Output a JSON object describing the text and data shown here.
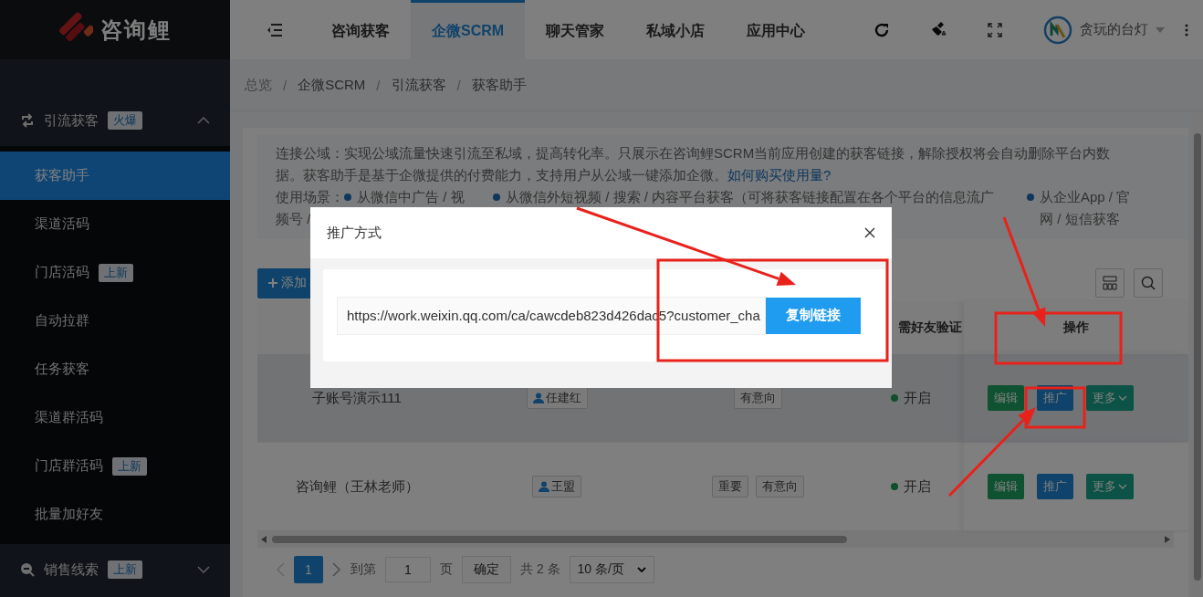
{
  "sidebar": {
    "logo": "咨询鲤",
    "groups": [
      {
        "label": "引流获客",
        "badge": "火爆",
        "expanded": true,
        "items": [
          {
            "label": "获客助手",
            "selected": true
          },
          {
            "label": "渠道活码",
            "selected": false
          },
          {
            "label": "门店活码",
            "badge": "上新",
            "selected": false
          },
          {
            "label": "自动拉群",
            "selected": false
          },
          {
            "label": "任务获客",
            "selected": false
          },
          {
            "label": "渠道群活码",
            "selected": false
          },
          {
            "label": "门店群活码",
            "badge": "上新",
            "selected": false
          },
          {
            "label": "批量加好友",
            "selected": false
          }
        ]
      },
      {
        "label": "销售线索",
        "badge": "上新",
        "expanded": false
      }
    ]
  },
  "header": {
    "tabs": [
      {
        "label": "咨询获客",
        "selected": false
      },
      {
        "label": "企微SCRM",
        "selected": true
      },
      {
        "label": "聊天管家",
        "selected": false
      },
      {
        "label": "私域小店",
        "selected": false
      },
      {
        "label": "应用中心",
        "selected": false
      }
    ],
    "user": "贪玩的台灯"
  },
  "breadcrumb": {
    "separator": "/",
    "items": [
      "总览",
      "企微SCRM",
      "引流获客",
      "获客助手"
    ]
  },
  "notice": {
    "text": "连接公域：实现公域流量快速引流至私域，提高转化率。只展示在咨询鲤SCRM当前应用创建的获客链接，解除授权将会自动删除平台内数据。获客助手是基于企微提供的付费能力，支持用户从公域一键添加企微。",
    "link": "如何购买使用量?",
    "scene_label": "使用场景：",
    "scenes": [
      {
        "lines": [
          "从微信中广告 / 视",
          "频号 /"
        ]
      },
      {
        "lines": [
          "从微信外短视频 / 搜索 / 内容平台获客（可将获客链接配置在各个平台的信息流广"
        ]
      },
      {
        "lines": [
          "从企业App / 官",
          "网 / 短信获客"
        ]
      }
    ]
  },
  "toolbar": {
    "add_button": "添加"
  },
  "table": {
    "columns": [
      "需好友验证",
      "操作"
    ],
    "rows": [
      {
        "name": "子账号演示111",
        "owner": "任建红",
        "tags": [
          "有意向"
        ],
        "status": "开启",
        "hovered": true,
        "actions": [
          {
            "label": "编辑",
            "kind": "edit"
          },
          {
            "label": "推广",
            "kind": "promote"
          },
          {
            "label": "更多",
            "kind": "more"
          }
        ]
      },
      {
        "name": "咨询鲤（王林老师）",
        "owner": "王盟",
        "tags": [
          "重要",
          "有意向"
        ],
        "status": "开启",
        "hovered": false,
        "actions": [
          {
            "label": "编辑",
            "kind": "edit"
          },
          {
            "label": "推广",
            "kind": "promote"
          },
          {
            "label": "更多",
            "kind": "more"
          }
        ]
      }
    ]
  },
  "pagination": {
    "pages": [
      {
        "label": "1",
        "selected": true
      }
    ],
    "goto_label": "到第",
    "goto_value": "1",
    "page_unit": "页",
    "confirm": "确定",
    "total": "共 2 条",
    "page_size": "10 条/页"
  },
  "modal": {
    "title": "推广方式",
    "url": "https://work.weixin.qq.com/ca/cawcdeb823d426dac5?customer_cha",
    "copy_button": "复制链接"
  }
}
